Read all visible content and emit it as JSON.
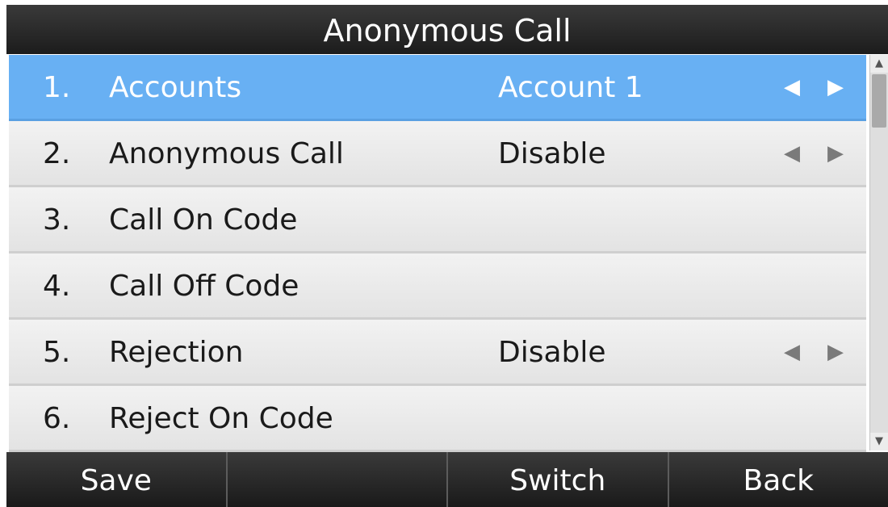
{
  "title": "Anonymous Call",
  "rows": [
    {
      "num": "1.",
      "label": "Accounts",
      "value": "Account 1",
      "selected": true,
      "arrows": true
    },
    {
      "num": "2.",
      "label": "Anonymous Call",
      "value": "Disable",
      "selected": false,
      "arrows": true
    },
    {
      "num": "3.",
      "label": "Call On Code",
      "value": "",
      "selected": false,
      "arrows": false
    },
    {
      "num": "4.",
      "label": "Call Off Code",
      "value": "",
      "selected": false,
      "arrows": false
    },
    {
      "num": "5.",
      "label": "Rejection",
      "value": "Disable",
      "selected": false,
      "arrows": true
    },
    {
      "num": "6.",
      "label": "Reject On Code",
      "value": "",
      "selected": false,
      "arrows": false
    }
  ],
  "arrows": {
    "left": "◀",
    "right": "▶"
  },
  "scrollbar": {
    "up": "▲",
    "down": "▼"
  },
  "softkeys": [
    "Save",
    "",
    "Switch",
    "Back"
  ],
  "colors": {
    "selected_row": "#68b0f3",
    "title_bar": "#1c1c1c",
    "softkey_bar": "#1a1a1a"
  }
}
